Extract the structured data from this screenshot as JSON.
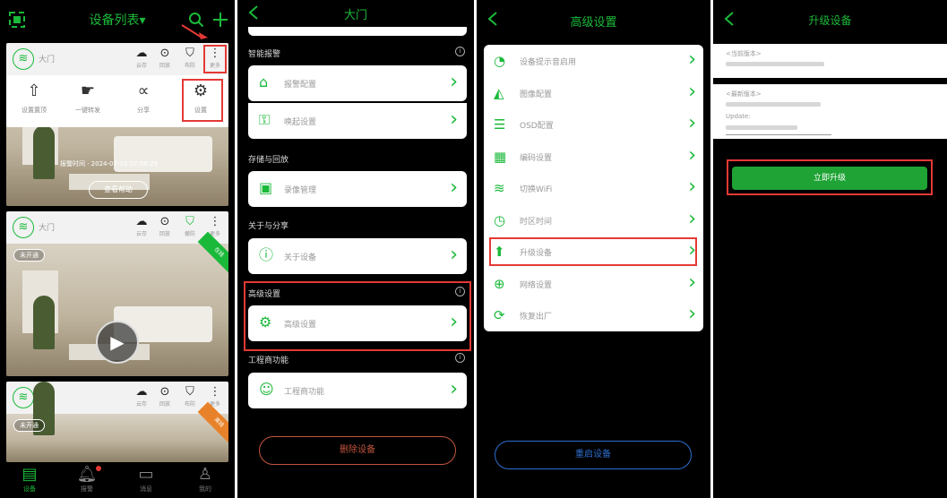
{
  "panel1": {
    "title": "设备列表▾",
    "scan_icon": "scan-icon",
    "cameras": [
      {
        "name": "大门",
        "actions": [
          "云存",
          "回放",
          "布防",
          "更多"
        ],
        "alarm_time": "报警时间 · 2024-07-18 07:58:29",
        "help_label": "查看帮助"
      },
      {
        "name": "大门",
        "actions": [
          "云存",
          "回放",
          "撤防",
          "更多"
        ],
        "status": "未开通",
        "corner": "在线"
      },
      {
        "name": "大门",
        "actions": [
          "云存",
          "回放",
          "布防",
          "更多"
        ],
        "status": "未开通",
        "corner": "离线"
      }
    ],
    "popup_menu": [
      "设置置顶",
      "一键转发",
      "分享",
      "设置"
    ],
    "tabs": [
      "设备",
      "报警",
      "消息",
      "我的"
    ]
  },
  "panel2": {
    "title": "大门",
    "sections": [
      {
        "label": "智能报警",
        "rows": [
          "报警配置",
          "唤起设置"
        ]
      },
      {
        "label": "存储与回放",
        "rows": [
          "录像管理"
        ]
      },
      {
        "label": "关于与分享",
        "rows": [
          "关于设备"
        ]
      },
      {
        "label": "高级设置",
        "rows": [
          "高级设置"
        ]
      },
      {
        "label": "工程商功能",
        "rows": [
          "工程商功能"
        ]
      }
    ],
    "delete_button": "删除设备"
  },
  "panel3": {
    "title": "高级设置",
    "rows": [
      "设备提示音启用",
      "图像配置",
      "OSD配置",
      "编码设置",
      "切换WiFi",
      "时区时间",
      "升级设备",
      "网络设置",
      "恢复出厂"
    ],
    "restart_button": "重启设备"
  },
  "panel4": {
    "title": "升级设备",
    "current_version_label": "<当前版本>",
    "latest_version_label": "<最新版本>",
    "update_label": "Update:",
    "upgrade_button": "立即升级"
  },
  "colors": {
    "accent": "#1bb93a",
    "highlight": "#e53935",
    "delete": "#c0553d",
    "restart": "#2f6fd0"
  }
}
